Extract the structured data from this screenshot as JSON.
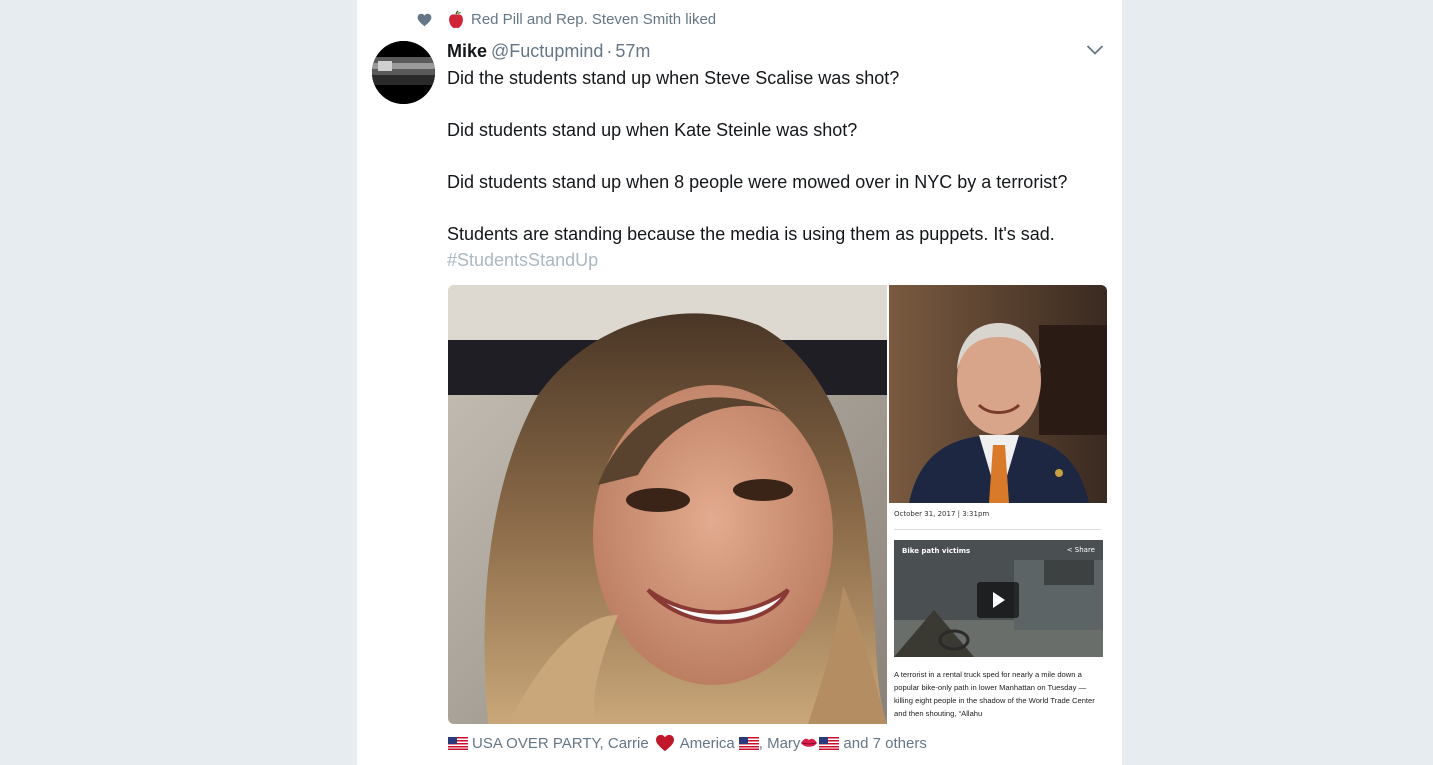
{
  "social_context": {
    "liked_by_text": "Red Pill and Rep. Steven Smith liked",
    "icon": "heart-icon",
    "emoji": "apple-icon"
  },
  "tweet": {
    "name": "Mike",
    "handle": "@Fuctupmind",
    "separator": "·",
    "time": "57m",
    "lines": [
      "Did the students stand up when Steve Scalise was shot?",
      "Did students stand up when Kate Steinle was shot?",
      "Did students stand up when 8 people were mowed over in NYC by a terrorist?",
      "Students are standing because the media is using them as puppets. It's sad."
    ],
    "hashtag": "#StudentsStandUp"
  },
  "article": {
    "date": "October 31, 2017 | 3:31pm",
    "video_title": "Bike path victims",
    "video_share": "< Share",
    "body": "A terrorist in a rental truck sped for nearly a mile down a popular bike-only path in lower Manhattan on Tuesday — killing eight people in the shadow of the World Trade Center and then shouting, “Allahu"
  },
  "likers": {
    "part1": "USA OVER PARTY, Carrie",
    "part2": "America",
    "part3": ", Mary",
    "part4": "and 7 others"
  },
  "colors": {
    "background": "#e6ecf0",
    "text": "#14171a",
    "secondary": "#657786",
    "hashtag": "#aab8c2",
    "heart_red": "#c0182a"
  }
}
